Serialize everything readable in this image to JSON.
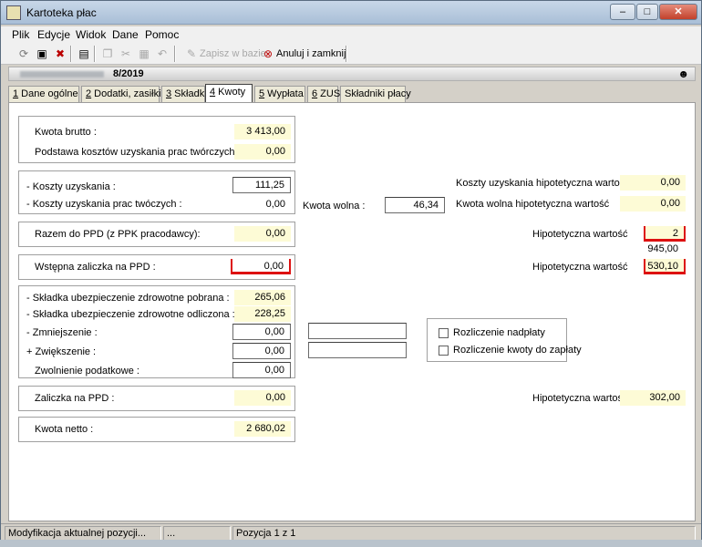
{
  "window": {
    "title": "Kartoteka płac",
    "controls": [
      "–",
      "□",
      "✕"
    ]
  },
  "menu": [
    "Plik",
    "Edycje",
    "Widok",
    "Dane",
    "Pomoc"
  ],
  "toolbar": {
    "save_label": "Zapisz w bazie",
    "cancel_close_label": "Anuluj i zamknij"
  },
  "header": {
    "period": "8/2019"
  },
  "tabs": [
    {
      "num": "1",
      "label": " Dane ogólne"
    },
    {
      "num": "2",
      "label": " Dodatki, zasiłki"
    },
    {
      "num": "3",
      "label": " Składki"
    },
    {
      "num": "4",
      "label": " Kwoty"
    },
    {
      "num": "5",
      "label": " Wypłata"
    },
    {
      "num": "6",
      "label": " ZUS"
    },
    {
      "num": "",
      "label": "Składniki płacy"
    }
  ],
  "form": {
    "kwota_brutto": {
      "label": "Kwota brutto :",
      "value": "3 413,00"
    },
    "podstawa_kosztow": {
      "label": "Podstawa kosztów uzyskania prac twórczych :",
      "value": "0,00"
    },
    "koszty_uzyskania": {
      "label": "- Koszty uzyskania :",
      "value": "111,25"
    },
    "koszty_tworczych": {
      "label": "- Koszty uzyskania prac twóczych :",
      "value": "0,00"
    },
    "kwota_wolna": {
      "label": "Kwota wolna :",
      "value": "46,34"
    },
    "koszty_hipotetyczna": {
      "label": "Koszty uzyskania hipotetyczna wartość",
      "value": "0,00"
    },
    "kwota_wolna_hipotetyczna": {
      "label": "Kwota wolna hipotetyczna wartość",
      "value": "0,00"
    },
    "razem_do_ppd": {
      "label": "Razem do PPD (z PPK pracodawcy):",
      "value": "0,00"
    },
    "hipotetyczna_1": {
      "label": "Hipotetyczna wartość",
      "value": "2 945,00"
    },
    "wstepna_zaliczka": {
      "label": "Wstępna zaliczka na PPD :",
      "value": "0,00"
    },
    "hipotetyczna_2": {
      "label": "Hipotetyczna wartość",
      "value": "530,10"
    },
    "skladka_pobrana": {
      "label": "- Składka ubezpieczenie zdrowotne pobrana :",
      "value": "265,06"
    },
    "skladka_odliczona": {
      "label": "- Składka ubezpieczenie zdrowotne odliczona :",
      "value": "228,25"
    },
    "zmniejszenie": {
      "label": "- Zmniejszenie :",
      "value": "0,00",
      "note": ""
    },
    "zwiekszenie": {
      "label": "+ Zwiększenie :",
      "value": "0,00",
      "note": ""
    },
    "zwolnienie": {
      "label": "Zwolnienie podatkowe :",
      "value": "0,00"
    },
    "rozliczenie_nadplaty": {
      "label": "Rozliczenie nadpłaty",
      "checked": false
    },
    "rozliczenie_kwoty": {
      "label": "Rozliczenie kwoty do zapłaty",
      "checked": false
    },
    "zaliczka_ppd": {
      "label": "Zaliczka na PPD :",
      "value": "0,00"
    },
    "hipotetyczna_3": {
      "label": "Hipotetyczna wartość",
      "value": "302,00"
    },
    "kwota_netto": {
      "label": "Kwota netto :",
      "value": "2 680,02"
    }
  },
  "status": {
    "left": "Modyfikacja aktualnej pozycji...",
    "middle": "...",
    "right": "Pozycja 1 z 1"
  }
}
